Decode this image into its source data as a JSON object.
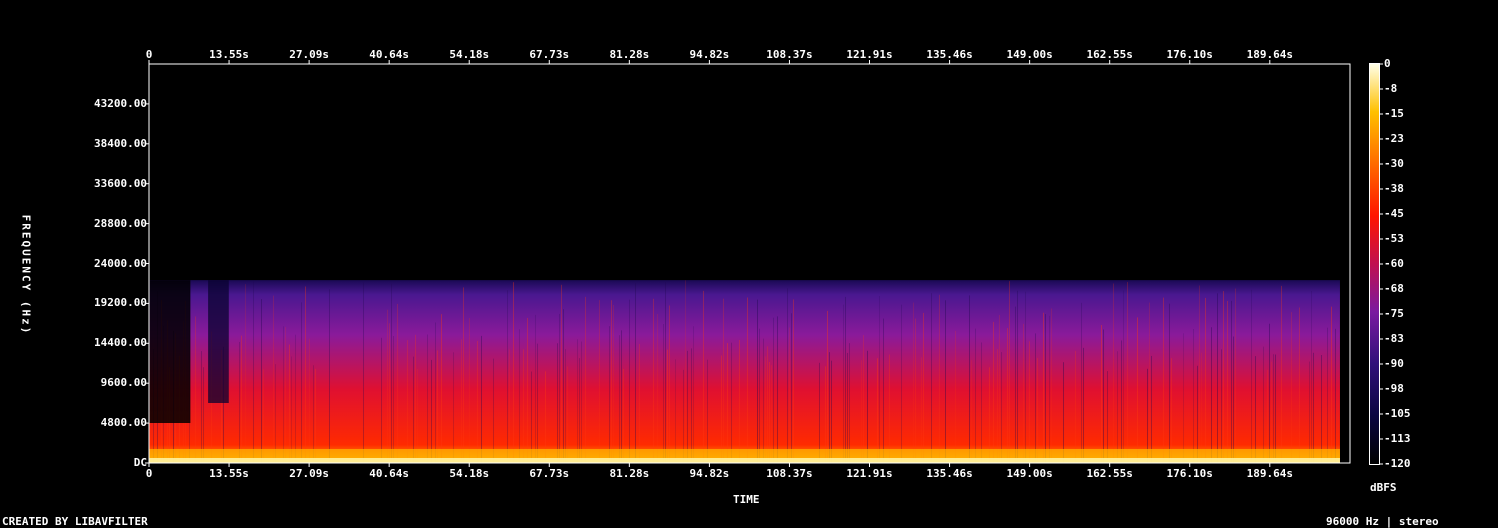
{
  "chart_data": {
    "type": "heatmap",
    "title": "",
    "xlabel": "TIME",
    "ylabel": "FREQUENCY (Hz)",
    "x_ticks": [
      "0",
      "13.55s",
      "27.09s",
      "40.64s",
      "54.18s",
      "67.73s",
      "81.28s",
      "94.82s",
      "108.37s",
      "121.91s",
      "135.46s",
      "149.00s",
      "162.55s",
      "176.10s",
      "189.64s"
    ],
    "y_ticks": [
      "DC",
      "4800.00",
      "9600.00",
      "14400.00",
      "19200.00",
      "24000.00",
      "28800.00",
      "33600.00",
      "38400.00",
      "43200.00"
    ],
    "xlim_seconds": [
      0,
      203.2
    ],
    "ylim_hz": [
      0,
      48000
    ],
    "colorbar": {
      "label": "dBFS",
      "ticks": [
        "0",
        "-8",
        "-15",
        "-23",
        "-30",
        "-38",
        "-45",
        "-53",
        "-60",
        "-68",
        "-75",
        "-83",
        "-90",
        "-98",
        "-105",
        "-113",
        "-120"
      ],
      "range": [
        -120,
        0
      ]
    },
    "content_cutoff_hz": 22000,
    "audio_end_seconds": 201.5,
    "colors": [
      "#000000",
      "#1a0a6e",
      "#6a1fb0",
      "#c81060",
      "#ff1a00",
      "#ff7a00",
      "#ffd000",
      "#ffffe0"
    ]
  },
  "footer": {
    "credit": "CREATED BY LIBAVFILTER",
    "info": "96000 Hz | stereo"
  }
}
